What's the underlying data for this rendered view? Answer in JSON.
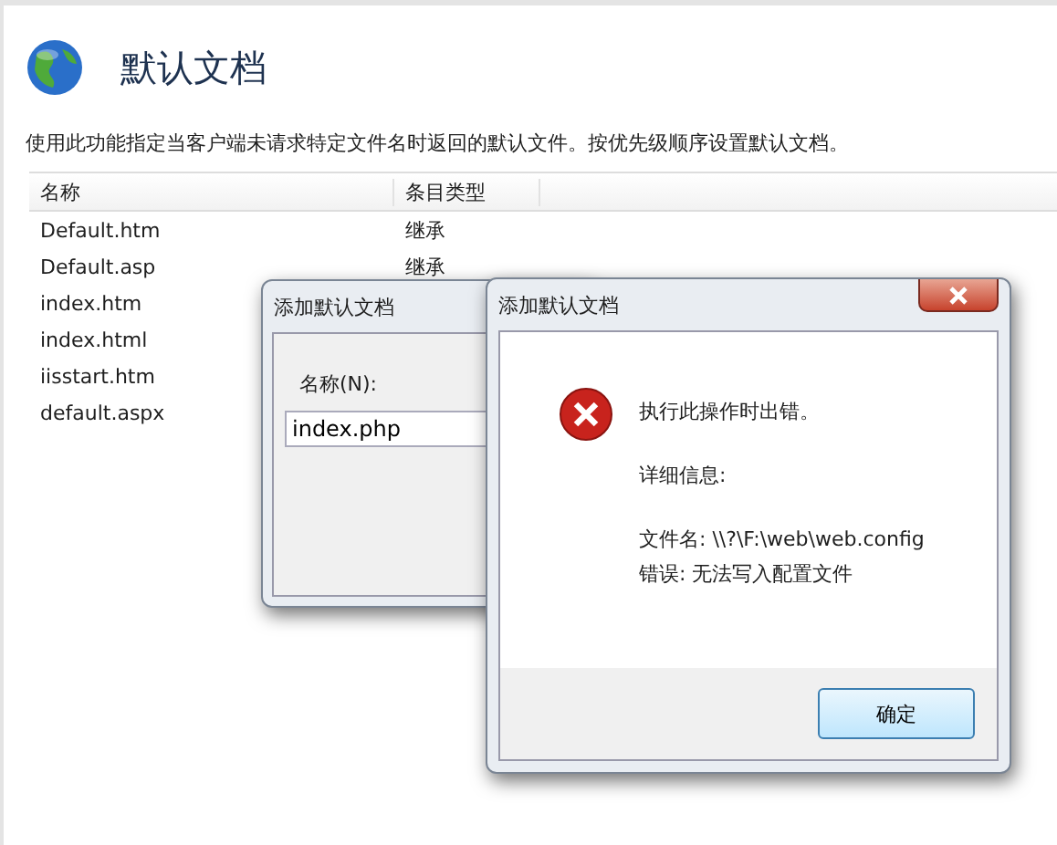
{
  "page": {
    "title": "默认文档",
    "description": "使用此功能指定当客户端未请求特定文件名时返回的默认文件。按优先级顺序设置默认文档。",
    "table": {
      "columns": [
        "名称",
        "条目类型"
      ],
      "rows": [
        {
          "name": "Default.htm",
          "type": "继承"
        },
        {
          "name": "Default.asp",
          "type": "继承"
        },
        {
          "name": "index.htm"
        },
        {
          "name": "index.html"
        },
        {
          "name": "iisstart.htm"
        },
        {
          "name": "default.aspx"
        }
      ]
    }
  },
  "add_dialog": {
    "title": "添加默认文档",
    "name_label": "名称(N):",
    "name_value": "index.php"
  },
  "error_dialog": {
    "title": "添加默认文档",
    "message": "执行此操作时出错。",
    "details_label": "详细信息:",
    "details": [
      "文件名: \\\\?\\F:\\web\\web.config",
      "错误: 无法写入配置文件"
    ],
    "buttons": [
      "确定"
    ]
  }
}
